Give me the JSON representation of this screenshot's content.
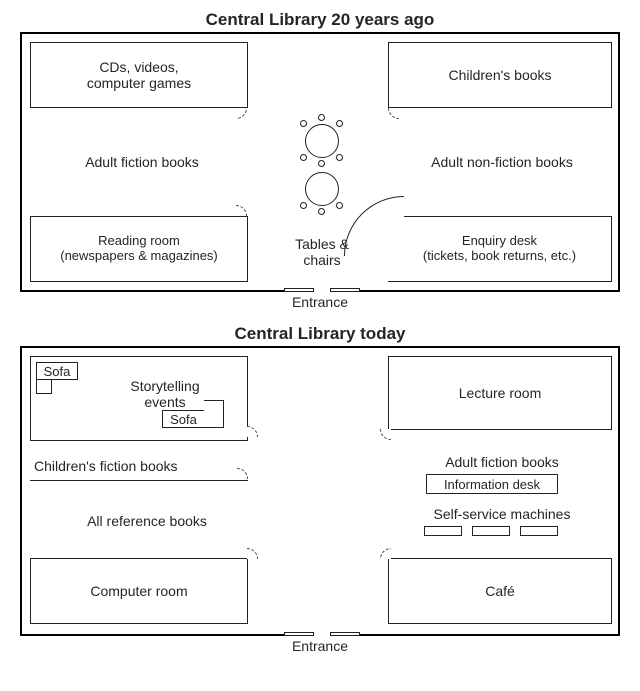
{
  "before": {
    "title": "Central Library 20 years ago",
    "rooms": {
      "cds": "CDs, videos,\ncomputer games",
      "children": "Children's books",
      "adult_fiction": "Adult fiction books",
      "adult_nonfiction": "Adult non-fiction books",
      "tables": "Tables &\nchairs",
      "reading": "Reading room\n(newspapers & magazines)",
      "enquiry": "Enquiry desk\n(tickets, book returns, etc.)"
    },
    "entrance": "Entrance"
  },
  "after": {
    "title": "Central Library today",
    "rooms": {
      "sofa": "Sofa",
      "storytelling": "Storytelling\nevents",
      "lecture": "Lecture room",
      "children_fiction": "Children's fiction books",
      "adult_fiction": "Adult fiction books",
      "info_desk": "Information desk",
      "all_reference": "All reference books",
      "self_service": "Self-service machines",
      "computer_room": "Computer room",
      "cafe": "Café"
    },
    "entrance": "Entrance"
  }
}
